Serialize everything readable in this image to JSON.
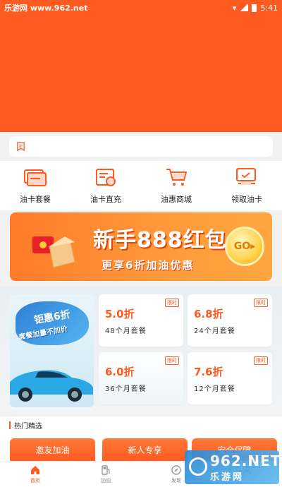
{
  "status_bar": {
    "watermark": "乐游网 www.962.net",
    "time": "5:41"
  },
  "colors": {
    "brand": "#ff5a1f",
    "card_bg": "#ffffff",
    "page_bg": "#f2f2f2"
  },
  "quick_menu": [
    {
      "label": "油卡套餐",
      "icon": "card-package-icon"
    },
    {
      "label": "油卡直充",
      "icon": "card-recharge-icon"
    },
    {
      "label": "油惠商城",
      "icon": "shopping-cart-icon"
    },
    {
      "label": "领取油卡",
      "icon": "claim-card-icon"
    }
  ],
  "banner": {
    "title": "新手888红包",
    "subtitle": "更享6折加油优惠",
    "go": "GO"
  },
  "promo": {
    "line1": "钜惠6折",
    "line2": "套餐加量不加价"
  },
  "packages": [
    {
      "discount": "5.0折",
      "duration": "48个月套餐",
      "tag": "限时"
    },
    {
      "discount": "6.8折",
      "duration": "24个月套餐",
      "tag": "限时"
    },
    {
      "discount": "6.0折",
      "duration": "36个月套餐",
      "tag": "限时"
    },
    {
      "discount": "7.6折",
      "duration": "12个月套餐",
      "tag": "限时"
    }
  ],
  "section": {
    "title": "热门精选"
  },
  "picks": [
    "邀友加油",
    "新人专享",
    "安全保障"
  ],
  "tabs": [
    {
      "label": "首页",
      "active": true
    },
    {
      "label": "加油",
      "active": false
    },
    {
      "label": "发现",
      "active": false
    },
    {
      "label": "",
      "active": false
    }
  ],
  "site_watermark": {
    "big": "962.NET",
    "small": "乐游网"
  }
}
